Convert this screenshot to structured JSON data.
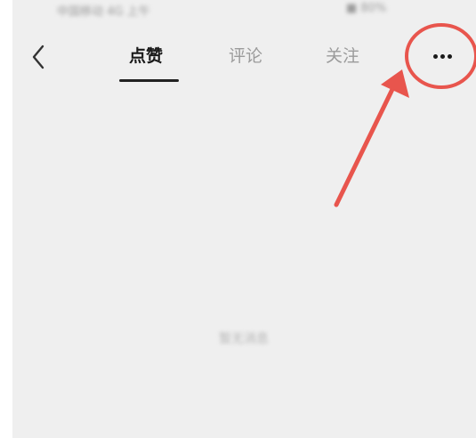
{
  "status_bar": {
    "left_text": "中国移动 4G 上午",
    "right_text": "■ 80%"
  },
  "nav": {
    "back_icon": "chevron-left-icon",
    "tabs": [
      {
        "label": "点赞",
        "active": true
      },
      {
        "label": "评论",
        "active": false
      },
      {
        "label": "关注",
        "active": false
      }
    ],
    "more_icon": "more-dots-icon"
  },
  "main": {
    "empty_text": "暂无消息"
  },
  "annotation": {
    "color": "#e8554d"
  }
}
